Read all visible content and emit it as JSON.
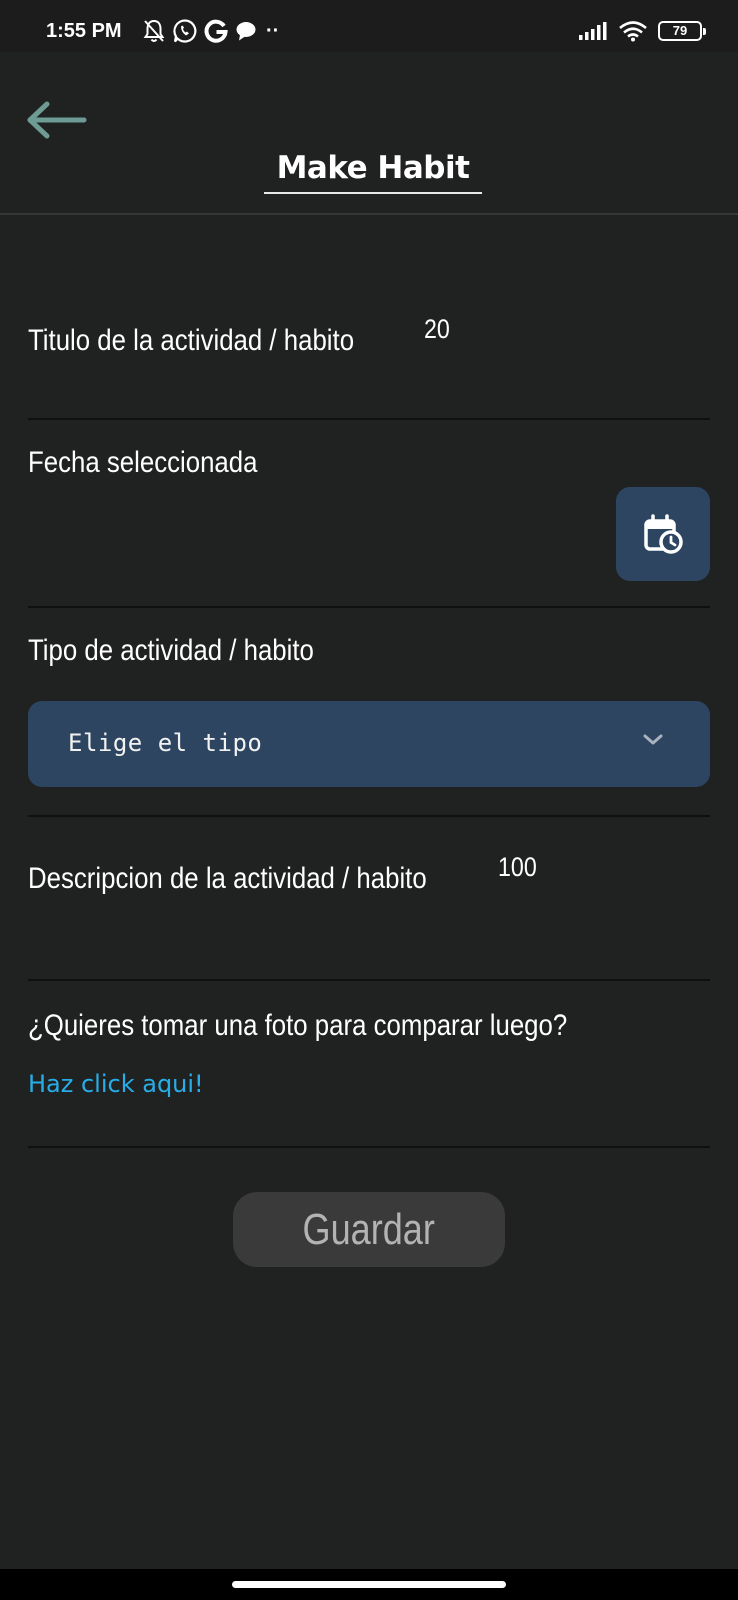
{
  "status_bar": {
    "time": "1:55 PM",
    "notification_icons": [
      "bell-off-icon",
      "whatsapp-icon",
      "google-icon",
      "chat-bubble-icon"
    ],
    "more_indicator": "··",
    "battery": "79"
  },
  "header": {
    "back_icon": "arrow-left-icon",
    "title": "Make Habit"
  },
  "form": {
    "title_field": {
      "label": "Titulo de la actividad / habito",
      "counter": "20"
    },
    "date_field": {
      "label": "Fecha seleccionada",
      "button_icon": "calendar-clock-icon"
    },
    "type_field": {
      "label": "Tipo de actividad / habito",
      "select_value": "Elige el tipo",
      "arrow_icon": "chevron-down-icon"
    },
    "description_field": {
      "label": "Descripcion de la actividad / habito",
      "counter": "100"
    },
    "photo": {
      "question": "¿Quieres tomar una foto para comparar luego?",
      "link": "Haz click aqui!"
    },
    "save_label": "Guardar"
  },
  "colors": {
    "background": "#202221",
    "accent_button": "#2d4560",
    "link": "#27aee8",
    "back_arrow": "#6e9c95",
    "save_button": "#3a3a3a"
  }
}
